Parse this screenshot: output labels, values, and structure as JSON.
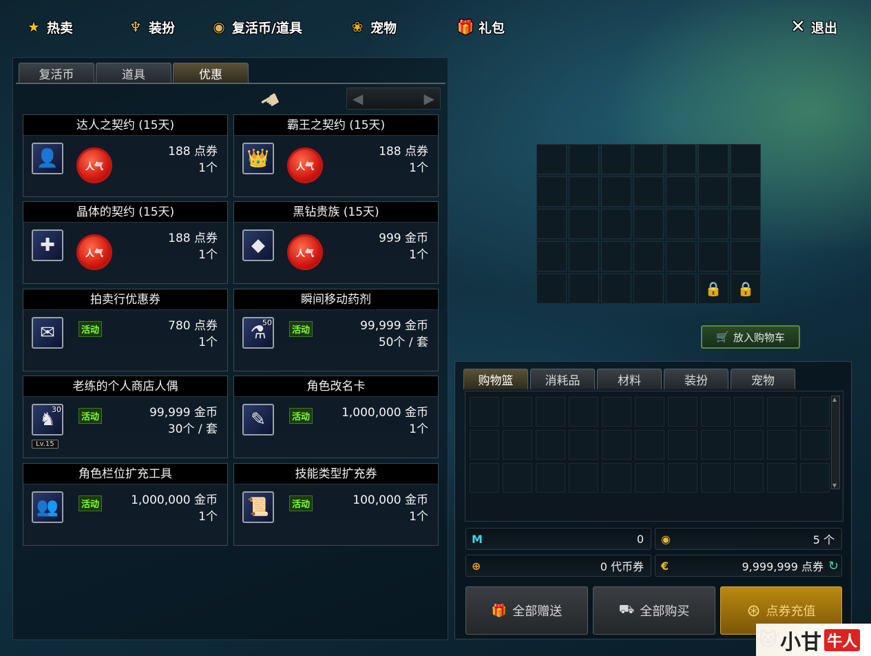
{
  "topnav": {
    "items": [
      {
        "label": "热卖",
        "icon": "star-icon",
        "glyph": "★"
      },
      {
        "label": "装扮",
        "icon": "trophy-icon",
        "glyph": "♆"
      },
      {
        "label": "复活币/道具",
        "icon": "coin-icon",
        "glyph": "◉"
      },
      {
        "label": "宠物",
        "icon": "paw-icon",
        "glyph": "❀"
      },
      {
        "label": "礼包",
        "icon": "gift-icon",
        "glyph": "🎁"
      }
    ],
    "exit_label": "退出",
    "exit_glyph": "✕"
  },
  "shop": {
    "tabs": [
      "复活币",
      "道具",
      "优惠"
    ],
    "active_tab": "优惠",
    "pager_prev": "◀",
    "pager_next": "▶",
    "items": [
      {
        "title": "达人之契约 (15天)",
        "icon": "warrior-portrait-icon",
        "glyph": "👤",
        "badge": "人气",
        "badge_type": "hot",
        "price": "188 点券",
        "qty": "1个"
      },
      {
        "title": "霸王之契约 (15天)",
        "icon": "golden-crown-icon",
        "glyph": "👑",
        "badge": "人气",
        "badge_type": "hot",
        "price": "188 点券",
        "qty": "1个"
      },
      {
        "title": "晶体的契约 (15天)",
        "icon": "crystal-grid-icon",
        "glyph": "✚",
        "badge": "人气",
        "badge_type": "hot",
        "price": "188 点券",
        "qty": "1个"
      },
      {
        "title": "黑钻贵族 (15天)",
        "icon": "black-diamond-icon",
        "glyph": "◆",
        "badge": "人气",
        "badge_type": "hot",
        "price": "999 金币",
        "qty": "1个"
      },
      {
        "title": "拍卖行优惠券",
        "icon": "coupon-icon",
        "glyph": "✉",
        "badge": "活动",
        "badge_type": "event",
        "price": "780 点券",
        "qty": "1个"
      },
      {
        "title": "瞬间移动药剂",
        "icon": "potion-icon",
        "glyph": "⚗",
        "badge": "活动",
        "badge_type": "event",
        "price": "99,999 金币",
        "qty": "50个 / 套",
        "stack": "50"
      },
      {
        "title": "老练的个人商店人偶",
        "icon": "doll-icon",
        "glyph": "♞",
        "badge": "活动",
        "badge_type": "event",
        "price": "99,999 金币",
        "qty": "30个 / 套",
        "stack": "30",
        "level": "Lv.15"
      },
      {
        "title": "角色改名卡",
        "icon": "rename-pen-icon",
        "glyph": "✎",
        "badge": "活动",
        "badge_type": "event",
        "price": "1,000,000 金币",
        "qty": "1个"
      },
      {
        "title": "角色栏位扩充工具",
        "icon": "add-character-icon",
        "glyph": "👥",
        "badge": "活动",
        "badge_type": "event",
        "price": "1,000,000 金币",
        "qty": "1个"
      },
      {
        "title": "技能类型扩充券",
        "icon": "scroll-icon",
        "glyph": "📜",
        "badge": "活动",
        "badge_type": "event",
        "price": "100,000 金币",
        "qty": "1个"
      }
    ]
  },
  "preview": {
    "add_to_cart_label": "放入购物车",
    "cart_glyph": "🛒",
    "lock_glyph": "🔒"
  },
  "cart": {
    "tabs": [
      "购物篮",
      "消耗品",
      "材料",
      "装扮",
      "宠物"
    ],
    "active_tab": "购物篮",
    "m_points": "0",
    "m_icon": "M",
    "coins_count": "5 个",
    "coin_icon": "◉",
    "voucher_value": "0 代币券",
    "voucher_icon": "⊕",
    "cera_value": "9,999,999 点券",
    "cera_icon": "€",
    "refresh_glyph": "↻",
    "gift_all_label": "全部赠送",
    "gift_glyph": "🎁",
    "buy_all_label": "全部购买",
    "buy_glyph": "⛟",
    "recharge_label": "点券充值",
    "recharge_glyph": "⊛"
  },
  "watermark": {
    "text1": "小甘",
    "text2": "牛人",
    "glyph": "🐱"
  },
  "colors": {
    "hot_badge": "#d41a12",
    "event_badge": "#7cff3a",
    "gold_button": "#b98912"
  }
}
